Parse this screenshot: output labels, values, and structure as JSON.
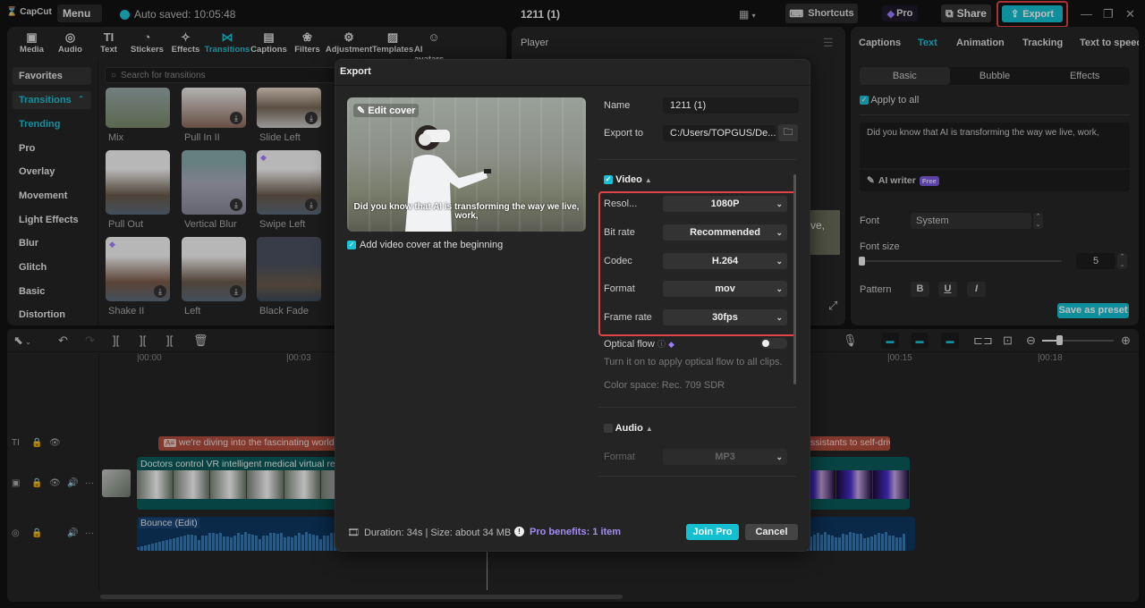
{
  "app": {
    "logo": "CapCut",
    "menu": "Menu",
    "autosave": "Auto saved: 10:05:48",
    "project_title": "1211 (1)"
  },
  "titlebar": {
    "shortcuts": "Shortcuts",
    "pro": "Pro",
    "share": "Share",
    "export": "Export",
    "minimize": "—",
    "restore": "❐",
    "close": "✕"
  },
  "colors": {
    "accent": "#19c1d4",
    "highlight": "#e04545",
    "pro": "#a48cf5"
  },
  "toolbar": {
    "tabs": [
      {
        "label": "Media",
        "icon": "media-icon"
      },
      {
        "label": "Audio",
        "icon": "audio-icon"
      },
      {
        "label": "Text",
        "icon": "text-icon"
      },
      {
        "label": "Stickers",
        "icon": "stickers-icon"
      },
      {
        "label": "Effects",
        "icon": "effects-icon"
      },
      {
        "label": "Transitions",
        "icon": "transitions-icon",
        "active": true
      },
      {
        "label": "Captions",
        "icon": "captions-icon"
      },
      {
        "label": "Filters",
        "icon": "filters-icon"
      },
      {
        "label": "Adjustment",
        "icon": "adjustment-icon"
      },
      {
        "label": "Templates",
        "icon": "templates-icon"
      },
      {
        "label": "AI avatars",
        "icon": "ai-avatars-icon"
      }
    ]
  },
  "sidebar": {
    "items": [
      "Favorites",
      "Transitions",
      "Trending",
      "Pro",
      "Overlay",
      "Movement",
      "Light Effects",
      "Blur",
      "Glitch",
      "Basic",
      "Distortion"
    ]
  },
  "search": {
    "placeholder": "Search for transitions"
  },
  "transitions": [
    {
      "label": "Mix"
    },
    {
      "label": "Pull In II"
    },
    {
      "label": "Slide Left"
    },
    {
      "label": "Pull Out"
    },
    {
      "label": "Vertical Blur"
    },
    {
      "label": "Swipe Left"
    },
    {
      "label": "Shake II"
    },
    {
      "label": "Left"
    },
    {
      "label": "Black Fade"
    }
  ],
  "player": {
    "title": "Player",
    "caption_partial": "ve,"
  },
  "right_panel": {
    "tabs": [
      "Captions",
      "Text",
      "Animation",
      "Tracking",
      "Text to speech"
    ],
    "active_tab": "Text",
    "segments": [
      "Basic",
      "Bubble",
      "Effects"
    ],
    "apply_all": "Apply to all",
    "text_value": "Did you know that AI is transforming the way we live, work,",
    "ai_writer": "AI writer",
    "free_badge": "Free",
    "font_label": "Font",
    "font_value": "System",
    "font_size_label": "Font size",
    "font_size_value": "5",
    "pattern_label": "Pattern",
    "save_preset": "Save as preset"
  },
  "dialog": {
    "title": "Export",
    "edit_cover": "Edit cover",
    "cover_subtitle": "Did you know that AI is transforming the way we live, work,",
    "add_cover": "Add video cover at the beginning",
    "name_label": "Name",
    "name_value": "1211 (1)",
    "export_to_label": "Export to",
    "export_to_value": "C:/Users/TOPGUS/De...",
    "video_label": "Video",
    "resolution_label": "Resol...",
    "resolution_value": "1080P",
    "bitrate_label": "Bit rate",
    "bitrate_value": "Recommended",
    "codec_label": "Codec",
    "codec_value": "H.264",
    "format_label": "Format",
    "format_value": "mov",
    "framerate_label": "Frame rate",
    "framerate_value": "30fps",
    "optical_flow_label": "Optical flow",
    "optical_flow_desc": "Turn it on to apply optical flow to all clips.",
    "color_space": "Color space: Rec. 709 SDR",
    "audio_label": "Audio",
    "audio_format_label": "Format",
    "audio_format_value": "MP3",
    "duration_size": "Duration: 34s | Size: about 34 MB",
    "pro_benefits": "Pro benefits: 1 item",
    "join_pro": "Join Pro",
    "cancel": "Cancel"
  },
  "timeline": {
    "ruler": [
      "00:00",
      "00:03",
      "00:15",
      "00:18"
    ],
    "caption_clip_1": "we're diving into the fascinating world of",
    "caption_clip_2": "ssistants to self-drivi",
    "video_clip": "Doctors control VR intelligent medical virtual real",
    "audio_clip": "Bounce (Edit)"
  }
}
